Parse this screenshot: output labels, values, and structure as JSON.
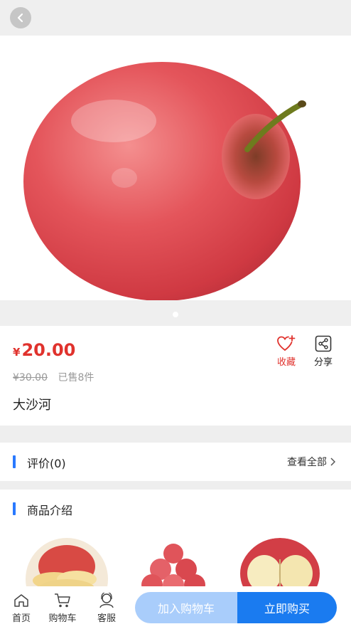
{
  "product": {
    "currency_symbol": "¥",
    "price": "20.00",
    "original_price": "¥30.00",
    "sold": "已售8件",
    "name": "大沙河"
  },
  "actions": {
    "favorite_label": "收藏",
    "share_label": "分享"
  },
  "review": {
    "title": "评价(0)",
    "view_all": "查看全部"
  },
  "intro": {
    "title": "商品介绍"
  },
  "tabbar": {
    "home": "首页",
    "cart": "购物车",
    "service": "客服",
    "add_to_cart": "加入购物车",
    "buy_now": "立即购买"
  },
  "colors": {
    "price_red": "#e0322d",
    "accent_blue": "#1a7bf0",
    "light_blue": "#a9cdfb"
  },
  "icons": [
    "back-icon",
    "heart-plus-icon",
    "share-icon",
    "chevron-right-icon",
    "home-icon",
    "cart-icon",
    "service-icon"
  ]
}
